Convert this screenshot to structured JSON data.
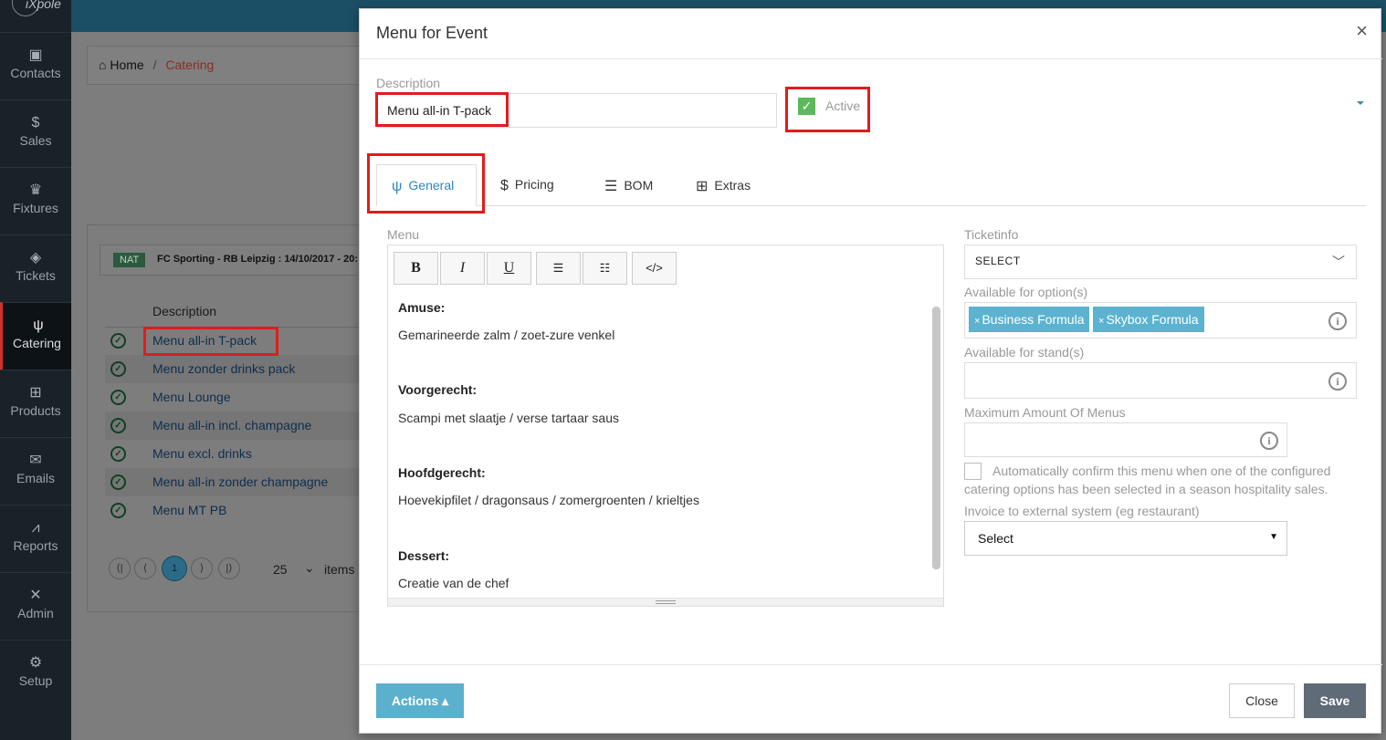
{
  "app": {
    "logo_text": "iXpole"
  },
  "sidebar": {
    "items": [
      {
        "label": "Contacts",
        "icon": "address-book-icon"
      },
      {
        "label": "Sales",
        "icon": "dollar-icon"
      },
      {
        "label": "Fixtures",
        "icon": "trophy-icon"
      },
      {
        "label": "Tickets",
        "icon": "ticket-icon"
      },
      {
        "label": "Catering",
        "icon": "cutlery-icon",
        "active": true
      },
      {
        "label": "Products",
        "icon": "cart-icon"
      },
      {
        "label": "Emails",
        "icon": "envelope-icon"
      },
      {
        "label": "Reports",
        "icon": "chart-icon"
      },
      {
        "label": "Admin",
        "icon": "tools-icon"
      },
      {
        "label": "Setup",
        "icon": "cogs-icon"
      }
    ]
  },
  "breadcrumb": {
    "home": "Home",
    "separator": "/",
    "current": "Catering"
  },
  "event": {
    "badge": "NAT",
    "title": "FC Sporting - RB Leipzig : 14/10/2017 - 20:"
  },
  "menu_list": {
    "column_header": "Description",
    "rows": [
      {
        "label": "Menu all-in T-pack"
      },
      {
        "label": "Menu zonder drinks pack"
      },
      {
        "label": "Menu Lounge"
      },
      {
        "label": "Menu all-in incl. champagne"
      },
      {
        "label": "Menu excl. drinks"
      },
      {
        "label": "Menu all-in zonder champagne"
      },
      {
        "label": "Menu MT PB"
      }
    ],
    "pager": {
      "first": "⟨|",
      "prev": "⟨",
      "page": "1",
      "next": "⟩",
      "last": "|⟩",
      "page_size": "25",
      "items_label": "items"
    }
  },
  "modal": {
    "title": "Menu for Event",
    "close_glyph": "×",
    "description_label": "Description",
    "description_value": "Menu all-in T-pack",
    "active_label": "Active",
    "active_checked": true,
    "tabs": [
      {
        "label": "General",
        "icon": "cutlery-icon",
        "active": true
      },
      {
        "label": "Pricing",
        "icon": "dollar-circle-icon"
      },
      {
        "label": "BOM",
        "icon": "list-icon"
      },
      {
        "label": "Extras",
        "icon": "cart-icon"
      }
    ],
    "menu_label": "Menu",
    "toolbar": {
      "bold": "B",
      "italic": "I",
      "underline": "U",
      "bullets": "☰",
      "numbered": "☷",
      "code": "</>"
    },
    "menu_content": [
      {
        "heading": "Amuse:",
        "text": "Gemarineerde zalm / zoet-zure venkel"
      },
      {
        "heading": "Voorgerecht:",
        "text": "Scampi met slaatje / verse tartaar saus"
      },
      {
        "heading": "Hoofdgerecht:",
        "text": "Hoevekipfilet / dragonsaus / zomergroenten / krieltjes"
      },
      {
        "heading": "Dessert:",
        "text": "Creatie van de chef"
      }
    ],
    "ticketinfo_label": "Ticketinfo",
    "ticketinfo_value": "SELECT",
    "options_label": "Available for option(s)",
    "options_tags": [
      "Business Formula",
      "Skybox Formula"
    ],
    "stands_label": "Available for stand(s)",
    "max_menus_label": "Maximum Amount Of Menus",
    "max_menus_value": "",
    "auto_confirm_text": "Automatically confirm this menu when one of the configured catering options has been selected in a season hospitality sales.",
    "invoice_label": "Invoice to external system (eg restaurant)",
    "invoice_value": "Select",
    "actions_label": "Actions ▴",
    "close_label": "Close",
    "save_label": "Save"
  },
  "colors": {
    "sidebar_bg": "#1a2229",
    "topbar_bg": "#1b4f66",
    "accent_blue": "#2c86c0",
    "actions_btn": "#5bb0ce",
    "save_btn": "#5f6b77",
    "tag_bg": "#5bb3cf",
    "active_check": "#5bb85b",
    "highlight_red": "#e21b1b"
  }
}
